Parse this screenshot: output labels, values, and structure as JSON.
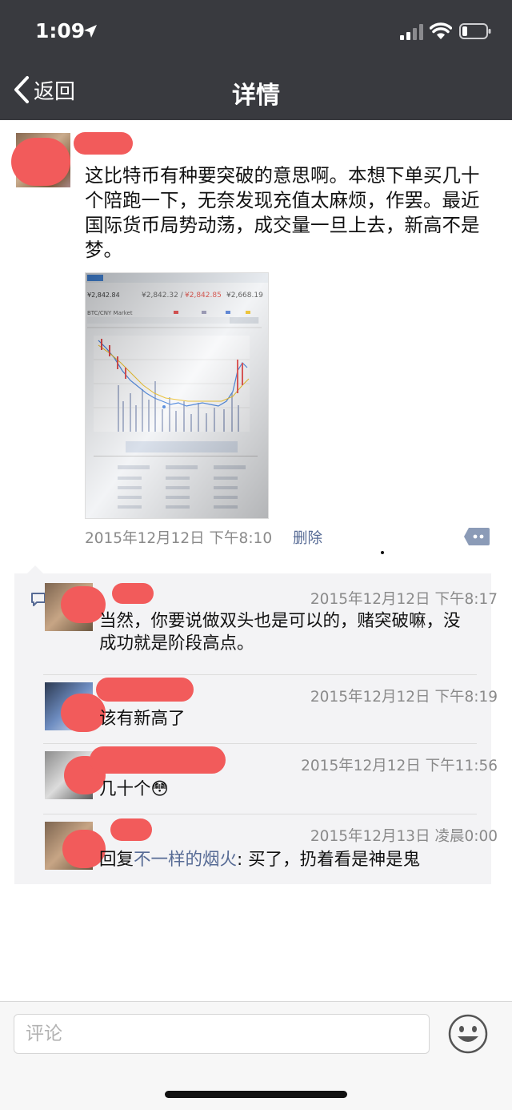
{
  "status_bar": {
    "time": "1:09"
  },
  "nav": {
    "back_label": "返回",
    "title": "详情"
  },
  "post": {
    "text": "这比特币有种要突破的意思啊。本想下单买几十个陪跑一下，无奈发现充值太麻烦，作罢。最近国际货币局势动荡，成交量一旦上去，新高不是梦。",
    "timestamp": "2015年12月12日 下午8:10",
    "delete_label": "删除",
    "image": {
      "price_main": "¥2,842.84",
      "price_bid_ask_1": "¥2,842.32 /",
      "price_bid_ask_2": "¥2,842.85",
      "price_right": "¥2,668.19",
      "market_label": "BTC/CNY Market"
    }
  },
  "comments": [
    {
      "timestamp": "2015年12月12日 下午8:17",
      "text": "当然，你要说做双头也是可以的，赌突破嘛，没成功就是阶段高点。"
    },
    {
      "timestamp": "2015年12月12日 下午8:19",
      "text": "该有新高了"
    },
    {
      "timestamp": "2015年12月12日 下午11:56",
      "text": "几十个",
      "emoji": "😳"
    },
    {
      "timestamp": "2015年12月13日 凌晨0:00",
      "reply_prefix": "回复",
      "reply_to": "不一样的烟火",
      "text": ": 买了，扔着看是神是鬼"
    }
  ],
  "input": {
    "placeholder": "评论"
  },
  "colors": {
    "nav_bg": "#393a3f",
    "link": "#576b95",
    "redaction": "#f25b5b",
    "comment_bg": "#f3f3f5"
  },
  "icons": [
    "location-arrow-icon",
    "signal-icon",
    "wifi-icon",
    "battery-icon",
    "back-chevron-icon",
    "more-dots-icon",
    "comment-bubble-icon",
    "emoji-icon"
  ]
}
